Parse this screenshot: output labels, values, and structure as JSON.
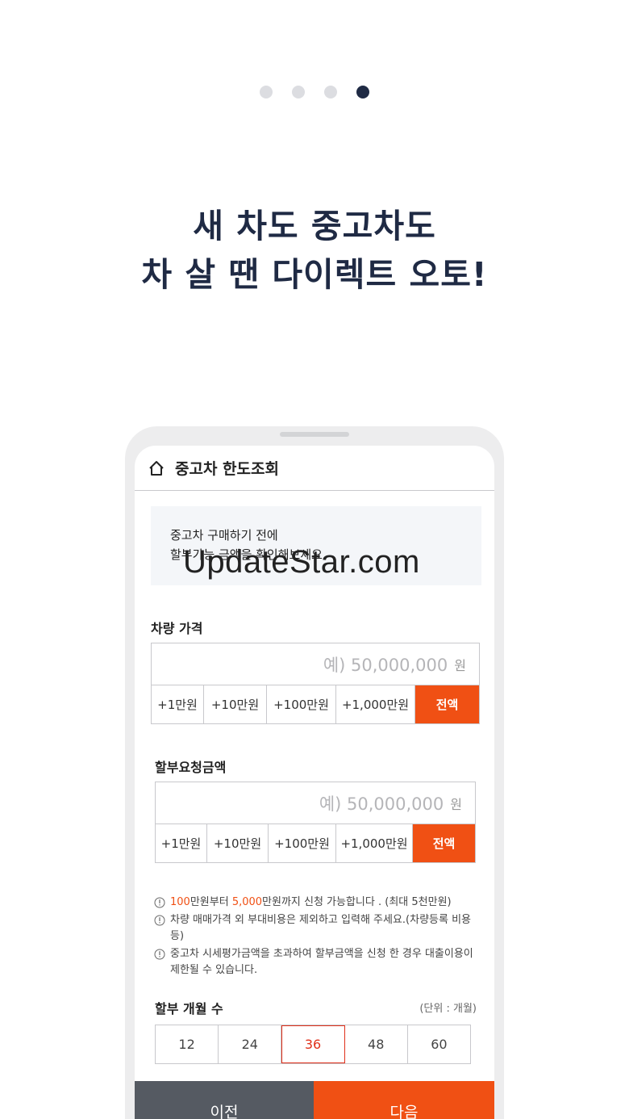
{
  "headline": {
    "line1": "새 차도 중고차도",
    "line2": "차 살 땐 다이렉트 오토!"
  },
  "app": {
    "title": "중고차 한도조회",
    "notice_line1": "중고차 구매하기 전에",
    "notice_line2": "할부가능 금액을 확인해보세요.",
    "watermark": "UpdateStar.com"
  },
  "vehicle_price": {
    "label": "차량 가격",
    "placeholder": "예) 50,000,000",
    "unit": "원",
    "buttons": [
      "+1만원",
      "+10만원",
      "+100만원",
      "+1,000만원"
    ],
    "full_label": "전액"
  },
  "installment_amount": {
    "label": "할부요청금액",
    "placeholder": "예) 50,000,000",
    "unit": "원",
    "buttons": [
      "+1만원",
      "+10만원",
      "+100만원",
      "+1,000만원"
    ],
    "full_label": "전액"
  },
  "notes": {
    "note1_min": "100",
    "note1_mid": "만원부터 ",
    "note1_max": "5,000",
    "note1_rest": "만원까지 신청 가능합니다 . (최대 5천만원)",
    "note2": "차량 매매가격 외 부대비용은 제외하고 입력해 주세요.(차량등록 비용 등)",
    "note3": "중고차 시세평가금액을 초과하여 할부금액을 신청 한 경우 대출이용이 제한될 수 있습니다."
  },
  "months": {
    "label": "할부 개월 수",
    "unit_note": "(단위 : 개월)",
    "options": [
      "12",
      "24",
      "36",
      "48",
      "60"
    ],
    "selected": "36"
  },
  "nav": {
    "prev": "이전",
    "next": "다음"
  },
  "colors": {
    "accent": "#f05014",
    "navy": "#1f2a44",
    "gray_button": "#555a62"
  }
}
